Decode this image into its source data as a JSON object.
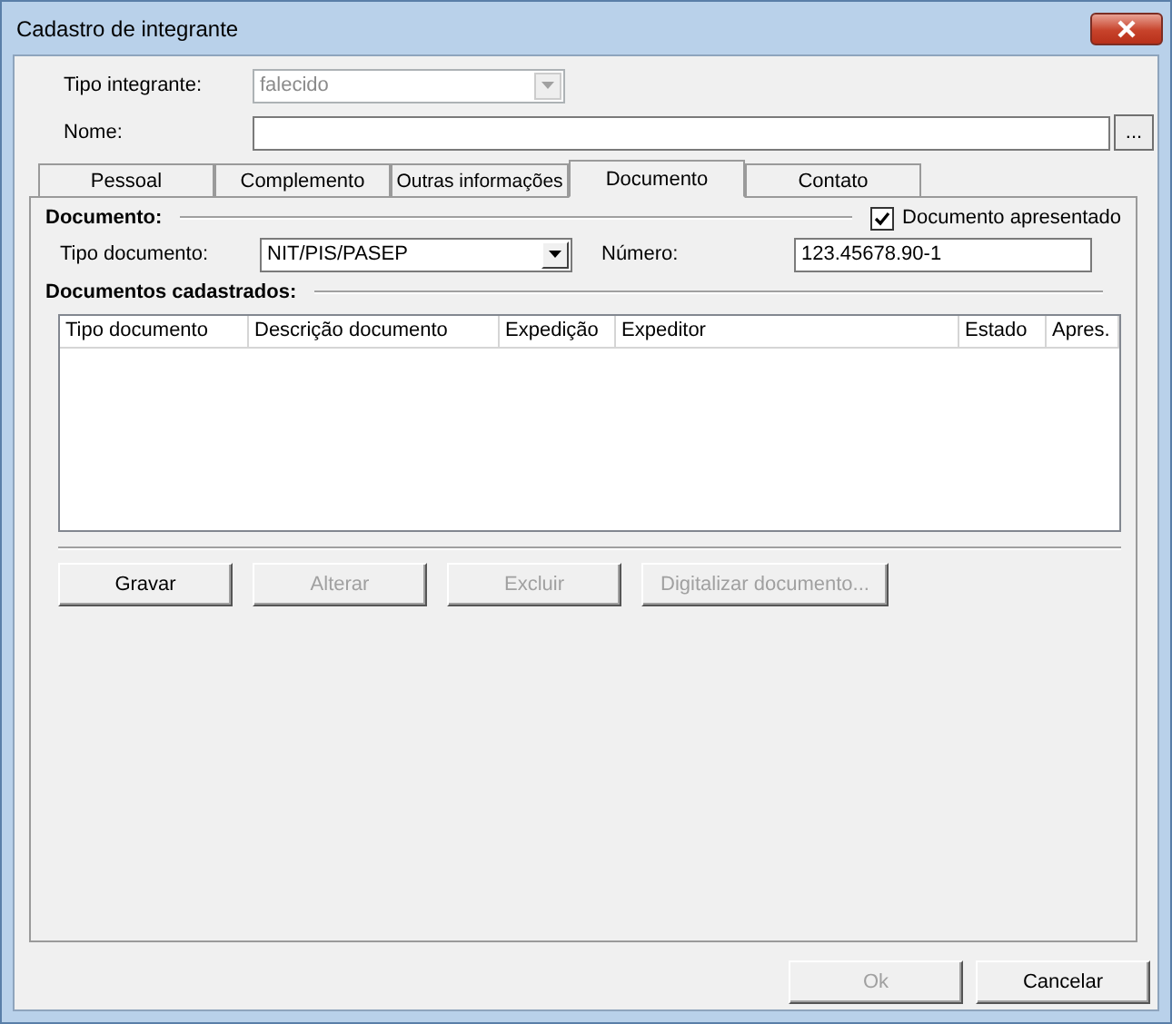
{
  "window": {
    "title": "Cadastro de integrante"
  },
  "fields": {
    "tipo_integrante": {
      "label": "Tipo integrante:",
      "value": "falecido",
      "disabled": true
    },
    "nome": {
      "label": "Nome:",
      "button": "..."
    }
  },
  "tabs": [
    {
      "label": "Pessoal",
      "selected": false
    },
    {
      "label": "Complemento",
      "selected": false
    },
    {
      "label": "Outras informações",
      "selected": false
    },
    {
      "label": "Documento",
      "selected": true
    },
    {
      "label": "Contato",
      "selected": false
    }
  ],
  "documento": {
    "heading": "Documento:",
    "presented": {
      "label": "Documento apresentado",
      "checked": true
    },
    "tipo_label": "Tipo documento:",
    "tipo_value": "NIT/PIS/PASEP",
    "numero_label": "Número:",
    "numero_value": "123.45678.90-1"
  },
  "cadastrados": {
    "heading": "Documentos cadastrados:",
    "columns": [
      "Tipo documento",
      "Descrição documento",
      "Expedição",
      "Expeditor",
      "Estado",
      "Apres."
    ]
  },
  "actions": [
    {
      "label": "Gravar",
      "disabled": false
    },
    {
      "label": "Alterar",
      "disabled": true
    },
    {
      "label": "Excluir",
      "disabled": true
    },
    {
      "label": "Digitalizar documento...",
      "disabled": true
    }
  ],
  "footer": [
    {
      "label": "Ok",
      "disabled": true
    },
    {
      "label": "Cancelar",
      "disabled": false
    }
  ]
}
